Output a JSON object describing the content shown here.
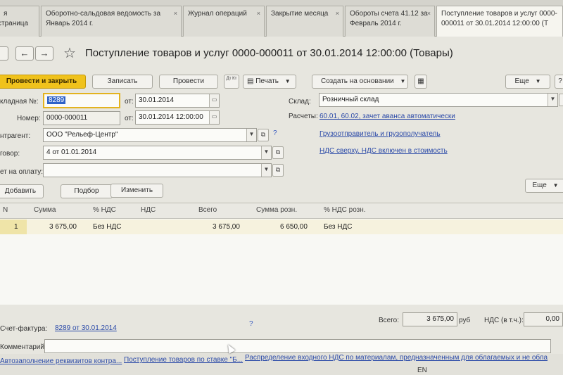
{
  "tabs": [
    {
      "label": "Начальная страница",
      "visible_text": "я страница",
      "active": false
    },
    {
      "label": "Оборотно-сальдовая ведомость за Январь 2014 г.",
      "active": false
    },
    {
      "label": "Журнал операций",
      "active": false
    },
    {
      "label": "Закрытие месяца",
      "active": false
    },
    {
      "label": "Обороты счета 41.12 за Февраль 2014 г.",
      "active": false
    },
    {
      "label": "Поступление товаров и услуг 0000-000011 от 30.01.2014 12:00:00 (Т",
      "active": true
    }
  ],
  "tab_close_icon": "×",
  "header": {
    "back_icon": "←",
    "forward_icon": "→",
    "star_icon": "☆",
    "title": "Поступление товаров и услуг 0000-000011 от 30.01.2014 12:00:00 (Товары)"
  },
  "toolbar": {
    "post_close": "Провести и закрыть",
    "save": "Записать",
    "post": "Провести",
    "dt_kt_icon": "Дт Кт",
    "print": "Печать",
    "create_based": "Создать на основании",
    "more": "Еще",
    "help": "?"
  },
  "form": {
    "invoice_no_label": "кладная №:",
    "invoice_no_value": "8289",
    "date_label": "от:",
    "date_value": "30.01.2014",
    "number_label": "Номер:",
    "number_value": "0000-000011",
    "datetime_label": "от:",
    "datetime_value": "30.01.2014 12:00:00",
    "contractor_label": "нтрагент:",
    "contractor_value": "ООО \"Рельеф-Центр\"",
    "contract_label": "говор:",
    "contract_value": "4 от 01.01.2014",
    "payment_label": "ет на оплату:",
    "payment_value": "",
    "warehouse_label": "Склад:",
    "warehouse_value": "Розничный склад",
    "settlements_label": "Расчеты:",
    "settlements_link": "60.01, 60.02, зачет аванса автоматически",
    "shipper_link": "Грузоотправитель и грузополучатель",
    "vat_link": "НДС сверху. НДС включен в стоимость"
  },
  "table_toolbar": {
    "add": "Добавить",
    "pick": "Подбор",
    "change": "Изменить",
    "more": "Еще"
  },
  "table": {
    "columns": [
      "N",
      "Сумма",
      "% НДС",
      "НДС",
      "Всего",
      "Сумма розн.",
      "% НДС розн."
    ],
    "rows": [
      {
        "n": "1",
        "sum": "3 675,00",
        "vat_rate": "Без НДС",
        "vat": "",
        "total": "3 675,00",
        "retail_sum": "6 650,00",
        "retail_vat_rate": "Без НДС"
      }
    ]
  },
  "footer": {
    "invoice_label": "Счет-фактура:",
    "invoice_link": "8289 от 30.01.2014",
    "total_label": "Всего:",
    "total_value": "3 675,00",
    "currency": "руб",
    "vat_label": "НДС (в т.ч.):",
    "vat_value": "0,00",
    "comment_label": "Комментарий:",
    "link1": "Автозаполнение реквизитов контра...",
    "link2": "Поступление товаров по ставке \"Б...",
    "link3": "Распределение входного НДС по материалам, предназначенным для облагаемых и не облагае...",
    "lang": "EN"
  }
}
